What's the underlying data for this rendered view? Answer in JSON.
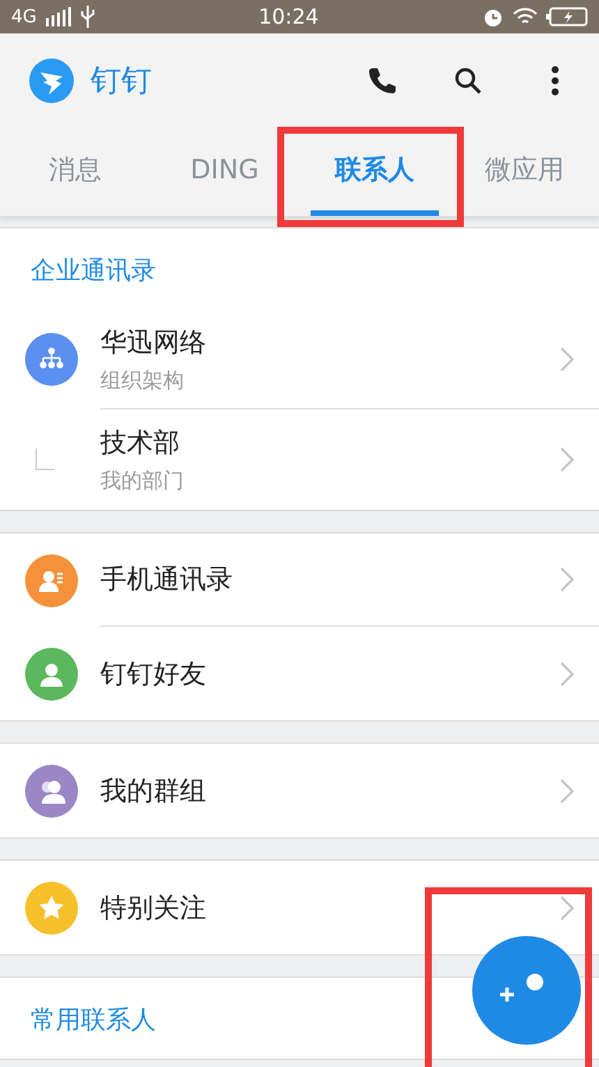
{
  "status_bar": {
    "network": "4G",
    "time": "10:24"
  },
  "app_bar": {
    "title": "钉钉"
  },
  "tabs": [
    {
      "label": "消息",
      "selected": false,
      "highlighted": false
    },
    {
      "label": "DING",
      "selected": false,
      "highlighted": false
    },
    {
      "label": "联系人",
      "selected": true,
      "highlighted": true
    },
    {
      "label": "微应用",
      "selected": false,
      "highlighted": false
    }
  ],
  "sections": [
    {
      "header": "企业通讯录",
      "items": [
        {
          "kind": "org",
          "title": "华迅网络",
          "subtitle": "组织架构",
          "color": "#5b8ff0"
        },
        {
          "kind": "dept",
          "title": "技术部",
          "subtitle": "我的部门"
        }
      ]
    },
    {
      "items": [
        {
          "kind": "phone",
          "title": "手机通讯录",
          "color": "#f5913a"
        },
        {
          "kind": "friend",
          "title": "钉钉好友",
          "color": "#5cb85c"
        }
      ]
    },
    {
      "items": [
        {
          "kind": "group",
          "title": "我的群组",
          "color": "#9b86c6"
        }
      ]
    },
    {
      "items": [
        {
          "kind": "star",
          "title": "特别关注",
          "color": "#f5c02a"
        }
      ]
    },
    {
      "header": "常用联系人"
    }
  ],
  "fab": {
    "highlighted": true
  }
}
